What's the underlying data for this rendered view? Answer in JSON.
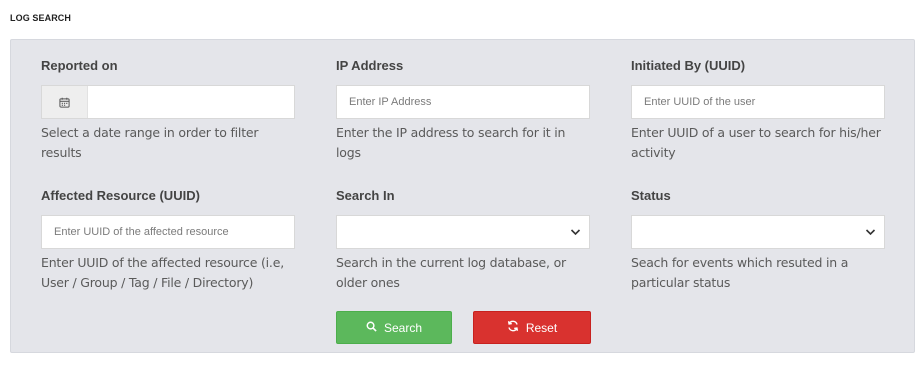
{
  "page": {
    "title": "LOG SEARCH"
  },
  "form": {
    "reported_on": {
      "label": "Reported on",
      "value": "",
      "help": "Select a date range in order to filter results",
      "icon": "calendar-icon"
    },
    "ip_address": {
      "label": "IP Address",
      "placeholder": "Enter IP Address",
      "help": "Enter the IP address to search for it in logs"
    },
    "initiated_by": {
      "label": "Initiated By (UUID)",
      "placeholder": "Enter UUID of the user",
      "help": "Enter UUID of a user to search for his/her activity"
    },
    "affected_resource": {
      "label": "Affected Resource (UUID)",
      "placeholder": "Enter UUID of the affected resource",
      "help": "Enter UUID of the affected resource (i.e, User / Group / Tag / File / Directory)"
    },
    "search_in": {
      "label": "Search In",
      "selected": "",
      "help": "Search in the current log database, or older ones",
      "icon": "chevron-down-icon"
    },
    "status": {
      "label": "Status",
      "selected": "",
      "help": "Seach for events which resuted in a particular status",
      "icon": "chevron-down-icon"
    }
  },
  "actions": {
    "search_label": "Search",
    "search_icon": "search-icon",
    "reset_label": "Reset",
    "reset_icon": "refresh-icon"
  },
  "colors": {
    "panel_bg": "#e4e5ea",
    "search_button": "#5cb85c",
    "reset_button": "#d9322f"
  }
}
